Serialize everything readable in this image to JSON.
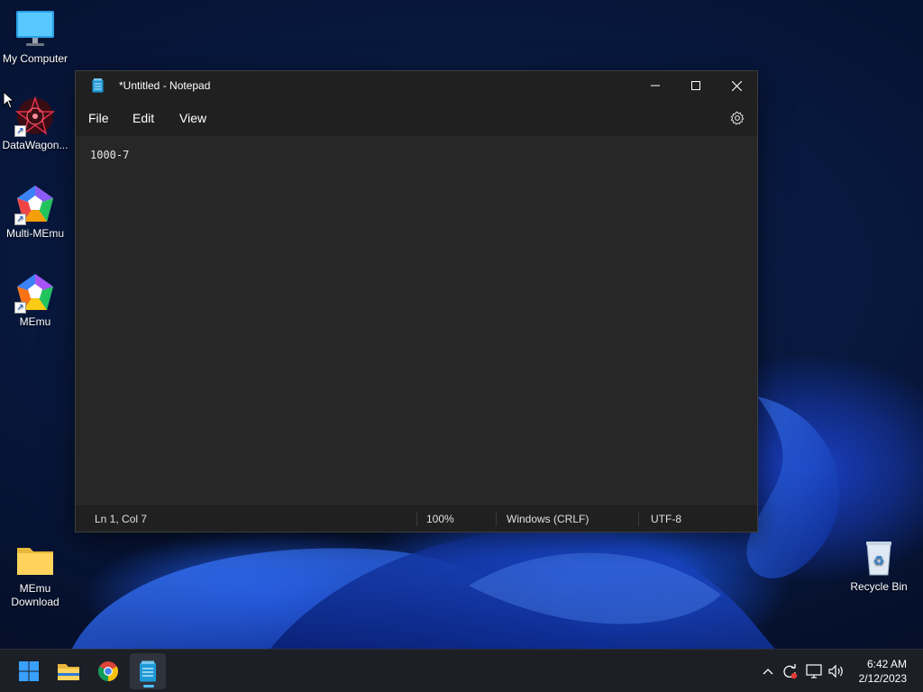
{
  "desktop": {
    "icons": [
      {
        "label": "My Computer"
      },
      {
        "label": "DataWagon..."
      },
      {
        "label": "Multi-MEmu"
      },
      {
        "label": "MEmu"
      },
      {
        "label": "MEmu Download"
      },
      {
        "label": "Recycle Bin"
      }
    ]
  },
  "notepad": {
    "title": "*Untitled - Notepad",
    "menu": {
      "file": "File",
      "edit": "Edit",
      "view": "View"
    },
    "content": "1000-7",
    "status": {
      "position": "Ln 1, Col 7",
      "zoom": "100%",
      "line_endings": "Windows (CRLF)",
      "encoding": "UTF-8"
    }
  },
  "taskbar": {
    "apps": [
      "start-icon",
      "file-explorer-icon",
      "chrome-icon",
      "notepad-icon"
    ],
    "tray": [
      "chevron-up-icon",
      "sync-icon",
      "network-icon",
      "volume-icon"
    ],
    "clock": {
      "time": "6:42 AM",
      "date": "2/12/2023"
    }
  },
  "colors": {
    "window_bg": "#272727",
    "titlebar_bg": "#202020",
    "taskbar_bg": "#1c1f26",
    "accent": "#4cc2ff"
  }
}
